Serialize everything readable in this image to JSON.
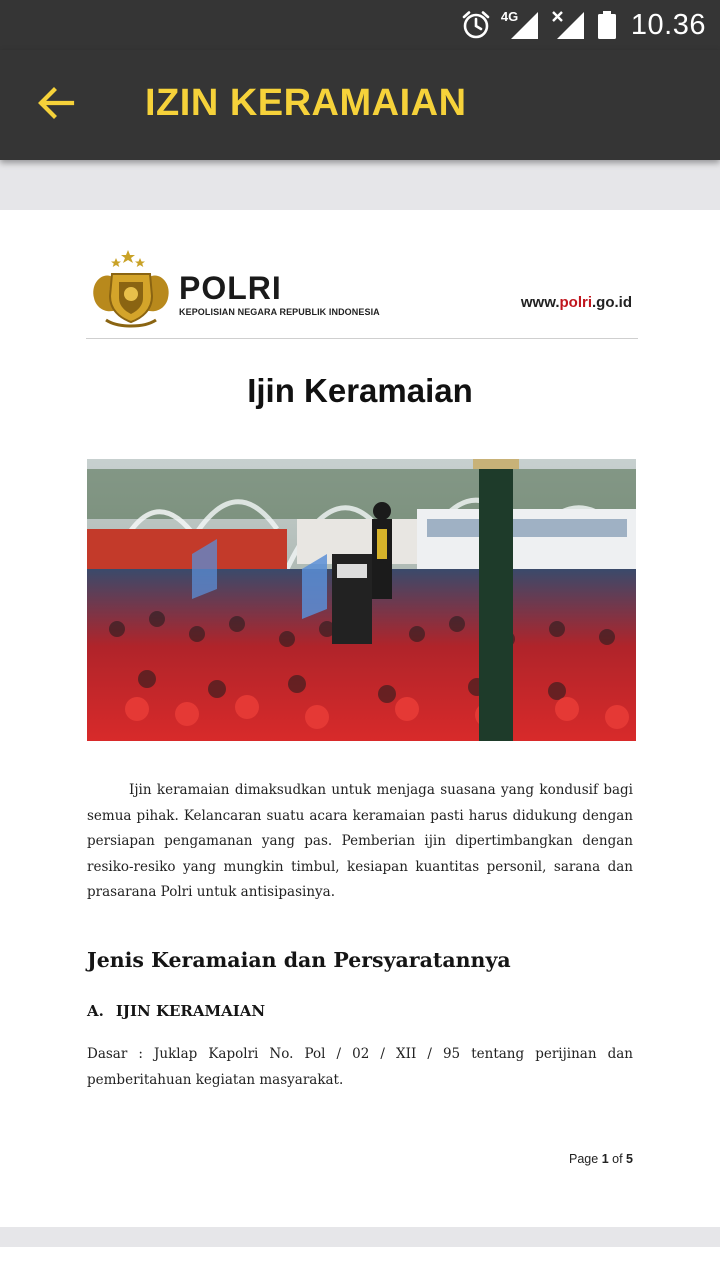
{
  "status_bar": {
    "network": "4G",
    "time": "10.36",
    "icons": [
      "alarm-icon",
      "signal-4g-icon",
      "signal-no-service-icon",
      "battery-icon"
    ]
  },
  "app_bar": {
    "title": "IZIN KERAMAIAN",
    "back_icon": "arrow-left-icon",
    "accent_color": "#f6d23a",
    "background_color": "#353535"
  },
  "document": {
    "header": {
      "org_name": "POLRI",
      "org_subtitle": "KEPOLISIAN NEGARA REPUBLIK INDONESIA",
      "url_prefix": "www.",
      "url_highlight": "polri",
      "url_suffix": ".go.id"
    },
    "title": "Ijin Keramaian",
    "intro": "Ijin keramaian dimaksudkan untuk menjaga suasana yang kondusif bagi semua pihak. Kelancaran suatu acara keramaian pasti harus didukung dengan persiapan pengamanan yang pas. Pemberian ijin dipertimbangkan dengan resiko-resiko yang mungkin timbul, kesiapan kuantitas personil, sarana dan prasarana Polri untuk antisipasinya.",
    "section_heading": "Jenis Keramaian dan Persyaratannya",
    "subsection_label": "A.",
    "subsection_title": "IJIN KERAMAIAN",
    "basis_text": "Dasar : Juklap Kapolri No. Pol / 02 / XII / 95 tentang perijinan dan pemberitahuan kegiatan masyarakat.",
    "page_prefix": "Page",
    "page_current": "1",
    "page_of": "of",
    "page_total": "5"
  }
}
